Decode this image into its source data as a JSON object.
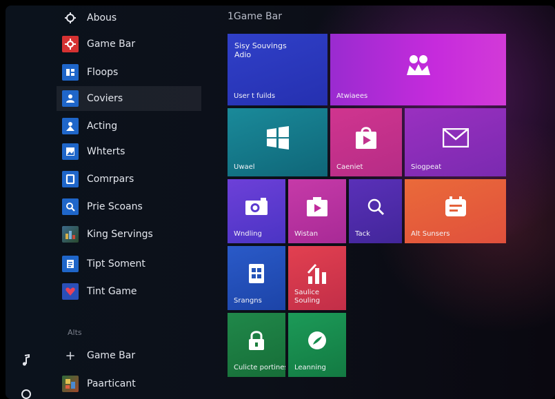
{
  "window": {
    "title": "1Game Bar"
  },
  "sidebar": {
    "top_item": "Abous",
    "items": [
      {
        "label": "Game Bar"
      },
      {
        "label": "Floops"
      },
      {
        "label": "Coviers"
      },
      {
        "label": "Acting"
      },
      {
        "label": "Whterts"
      },
      {
        "label": "Comrpars"
      },
      {
        "label": "Prie Scoans"
      },
      {
        "label": "King Servings"
      },
      {
        "label": "Tipt Soment"
      },
      {
        "label": "Tint Game"
      }
    ],
    "section_label": "Alts",
    "add_label": "Game Bar",
    "add_symbol": "+",
    "bottom_item": "Paarticant"
  },
  "tiles": [
    {
      "label": "User t fuilds",
      "top_text_1": "Sisy Souvings",
      "top_text_2": "Adio",
      "color": "#2b36c2",
      "icon": "none"
    },
    {
      "label": "Atwiaees",
      "color": "#b326d8",
      "icon": "people-icon"
    },
    {
      "label": "Uwael",
      "color": "#127a8a",
      "icon": "windows-icon"
    },
    {
      "label": "Caeniet",
      "color": "#c2338f",
      "icon": "store-bag-icon"
    },
    {
      "label": "Siogpeat",
      "color": "#8a2ab8",
      "icon": "mail-icon"
    },
    {
      "label": "Wndling",
      "color": "#5b3ad0",
      "icon": "camera-icon"
    },
    {
      "label": "Wistan",
      "color": "#c02a9c",
      "icon": "play-icon"
    },
    {
      "label": "Tack",
      "color": "#4b2aa8",
      "icon": "search-icon"
    },
    {
      "label": "Alt Sunsers",
      "color": "#e4613a",
      "icon": "calendar-icon"
    },
    {
      "label": "Srangns",
      "color": "#2353b8",
      "icon": "document-icon"
    },
    {
      "label": "Saulice Souling",
      "label_line_1": "Saulice",
      "label_line_2": "Souling",
      "color": "#d3364f",
      "icon": "bar-chart-icon"
    },
    {
      "label": "Culicte portines",
      "color": "#1b7d3c",
      "icon": "lock-icon"
    },
    {
      "label": "Leanning",
      "color": "#148c4d",
      "icon": "edge-icon"
    }
  ]
}
